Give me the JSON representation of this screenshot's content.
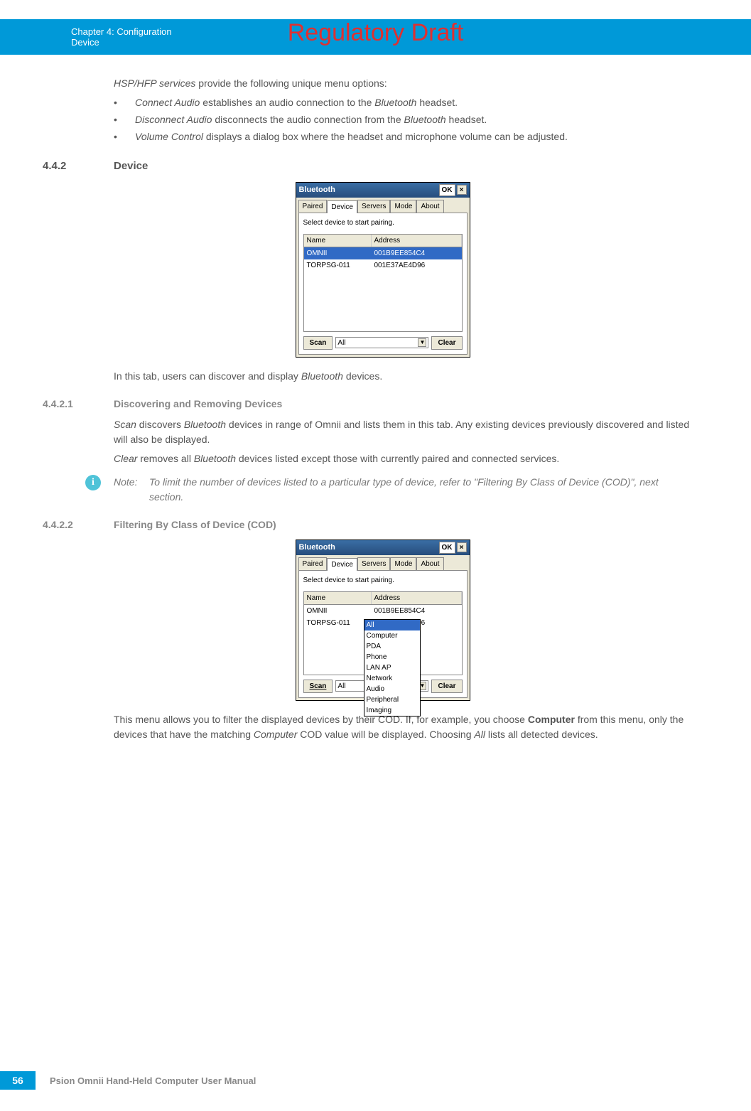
{
  "watermark": "Regulatory Draft",
  "chapter_bar": {
    "line1": "Chapter 4:  Configuration",
    "line2": "Device"
  },
  "intro": {
    "lead": "HSP/HFP services",
    "lead_tail": " provide the following unique menu options:",
    "bullets": [
      {
        "em1": "Connect Audio",
        "mid": " establishes an audio connection to the ",
        "em2": "Bluetooth",
        "tail": " headset."
      },
      {
        "em1": "Disconnect Audio",
        "mid": " disconnects the audio connection from the ",
        "em2": "Bluetooth",
        "tail": " headset."
      },
      {
        "em1": "Volume Control",
        "mid": " displays a dialog box where the headset and microphone volume can be adjusted.",
        "em2": "",
        "tail": ""
      }
    ]
  },
  "s442": {
    "num": "4.4.2",
    "title": "Device"
  },
  "win1": {
    "title": "Bluetooth",
    "ok": "OK",
    "x": "×",
    "tabs": [
      "Paired",
      "Device",
      "Servers",
      "Mode",
      "About"
    ],
    "hint": "Select device to start pairing.",
    "cols": [
      "Name",
      "Address"
    ],
    "rows": [
      {
        "name": "OMNII",
        "addr": "001B9EE854C4",
        "sel": true
      },
      {
        "name": "TORPSG-011",
        "addr": "001E37AE4D96",
        "sel": false
      }
    ],
    "scan": "Scan",
    "filter": "All",
    "clear": "Clear"
  },
  "s442_text": {
    "p1a": "In this tab, users can discover and display ",
    "p1b": "Bluetooth",
    "p1c": " devices."
  },
  "s4421": {
    "num": "4.4.2.1",
    "title": "Discovering and Removing Devices",
    "p1a": "Scan",
    "p1b": " discovers ",
    "p1c": "Bluetooth",
    "p1d": " devices in range of Omnii and lists them in this tab. Any existing devices previously discovered and listed will also be displayed.",
    "p2a": "Clear",
    "p2b": " removes all ",
    "p2c": "Bluetooth",
    "p2d": " devices listed except those with currently paired and connected services."
  },
  "note": {
    "label": "Note:",
    "text": "To limit the number of devices listed to a particular type of device, refer to \"Filtering By Class of Device (COD)\", next section."
  },
  "s4422": {
    "num": "4.4.2.2",
    "title": "Filtering By Class of Device (COD)"
  },
  "win2": {
    "dropdown": [
      "All",
      "Computer",
      "PDA",
      "Phone",
      "LAN AP",
      "Network",
      "Audio",
      "Peripheral",
      "Imaging"
    ]
  },
  "s4422_text": {
    "p1a": "This menu allows you to filter the displayed devices by their COD. If, for example, you choose ",
    "p1b": "Computer",
    "p1c": " from this menu, only the devices that have the matching ",
    "p1d": "Computer",
    "p1e": " COD value will be displayed. Choosing ",
    "p1f": "All",
    "p1g": " lists all detected devices."
  },
  "footer": {
    "page": "56",
    "text": "Psion Omnii Hand-Held Computer User Manual"
  }
}
